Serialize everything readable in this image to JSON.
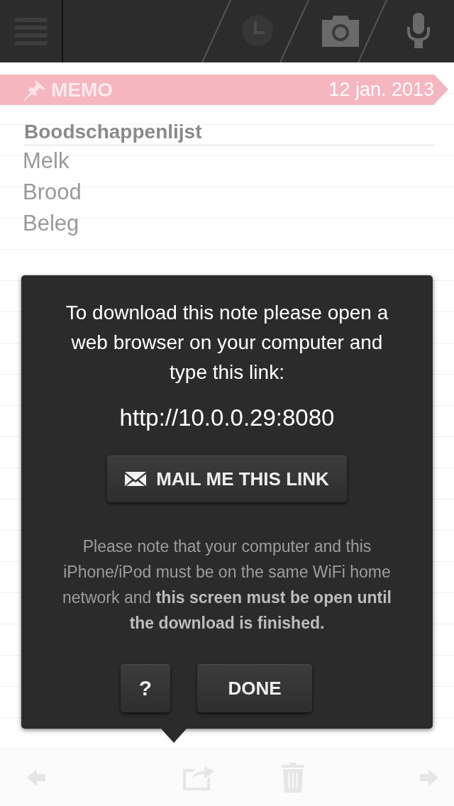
{
  "banner": {
    "label": "MEMO",
    "date": "12 jan. 2013"
  },
  "note": {
    "title": "Boodschappenlijst",
    "lines": [
      "Melk",
      "Brood",
      "Beleg"
    ]
  },
  "dialog": {
    "message": "To download this note please open a web browser on your computer and type this link:",
    "link": "http://10.0.0.29:8080",
    "mail_button": "MAIL ME THIS LINK",
    "note": "Please note that your computer and this iPhone/iPod must be on the same WiFi home network and **this screen must be open until the download is finished.**",
    "help_button": "?",
    "done_button": "DONE"
  }
}
